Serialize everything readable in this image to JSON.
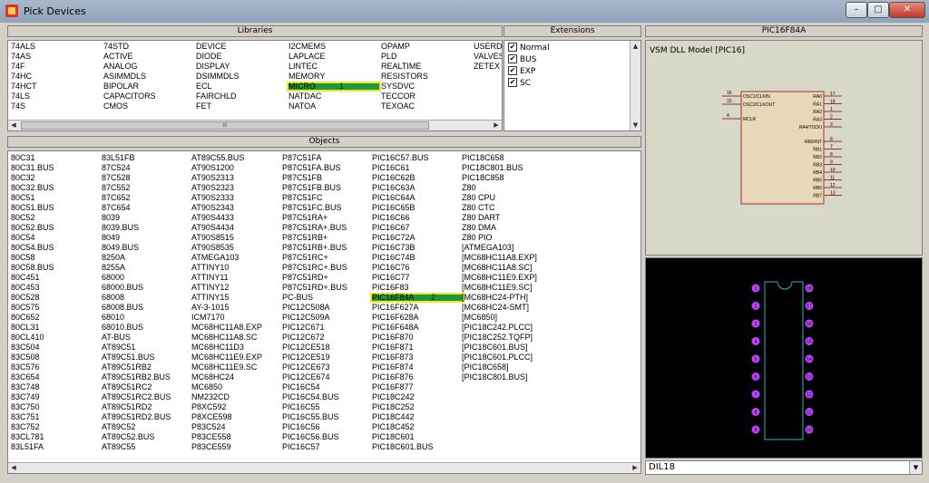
{
  "window": {
    "title": "Pick Devices",
    "min": "–",
    "max": "□",
    "close": "✕"
  },
  "libraries": {
    "header": "Libraries",
    "columns": [
      [
        "74ALS",
        "74AS",
        "74F",
        "74HC",
        "74HCT",
        "74LS",
        "74S"
      ],
      [
        "74STD",
        "ACTIVE",
        "ANALOG",
        "ASIMMDLS",
        "BIPOLAR",
        "CAPACITORS",
        "CMOS"
      ],
      [
        "DEVICE",
        "DIODE",
        "DISPLAY",
        "DSIMMDLS",
        "ECL",
        "FAIRCHLD",
        "FET"
      ],
      [
        "I2CMEMS",
        "LAPLACE",
        "LINTEC",
        "MEMORY",
        "MICRO",
        "NATDAC",
        "NATOA"
      ],
      [
        "OPAMP",
        "PLD",
        "REALTIME",
        "RESISTORS",
        "SYSDVC",
        "TECCOR",
        "TEXOAC"
      ],
      [
        "USERD",
        "VALVES",
        "ZETEX"
      ]
    ],
    "highlight_number": "1",
    "scroll_thumb": "III"
  },
  "extensions": {
    "header": "Extensions",
    "items": [
      {
        "label": "Normal",
        "checked": "✔"
      },
      {
        "label": "BUS",
        "checked": "✔"
      },
      {
        "label": "EXP",
        "checked": "✔"
      },
      {
        "label": "SC",
        "checked": "✔"
      }
    ]
  },
  "objects": {
    "header": "Objects",
    "columns": [
      [
        "80C31",
        "80C31.BUS",
        "80C32",
        "80C32.BUS",
        "80C51",
        "80C51.BUS",
        "80C52",
        "80C52.BUS",
        "80C54",
        "80C54.BUS",
        "80C58",
        "80C58.BUS",
        "80C451",
        "80C453",
        "80C528",
        "80C575",
        "80C652",
        "80CL31",
        "80CL410",
        "83C504",
        "83C508",
        "83C576",
        "83C654",
        "83C748",
        "83C749",
        "83C750",
        "83C751",
        "83C752",
        "83CL781",
        "83L51FA"
      ],
      [
        "83L51FB",
        "87C524",
        "87C528",
        "87C552",
        "87C652",
        "87C654",
        "8039",
        "8039.BUS",
        "8049",
        "8049.BUS",
        "8250A",
        "8255A",
        "68000",
        "68000.BUS",
        "68008",
        "68008.BUS",
        "68010",
        "68010.BUS",
        "AT-BUS",
        "AT89C51",
        "AT89C51.BUS",
        "AT89C51RB2",
        "AT89C51RB2.BUS",
        "AT89C51RC2",
        "AT89C51RC2.BUS",
        "AT89C51RD2",
        "AT89C51RD2.BUS",
        "AT89C52",
        "AT89C52.BUS",
        "AT89C55"
      ],
      [
        "AT89C55.BUS",
        "AT90S1200",
        "AT90S2313",
        "AT90S2323",
        "AT90S2333",
        "AT90S2343",
        "AT90S4433",
        "AT90S4434",
        "AT90S8515",
        "AT90S8535",
        "ATMEGA103",
        "ATTINY10",
        "ATTINY11",
        "ATTINY12",
        "ATTINY15",
        "AY-3-1015",
        "ICM7170",
        "MC68HC11A8.EXP",
        "MC68HC11A8.SC",
        "MC68HC11D3",
        "MC68HC11E9.EXP",
        "MC68HC11E9.SC",
        "MC68HC24",
        "MC6850",
        "NM232CD",
        "P8XC592",
        "P8XCE598",
        "P83C524",
        "P83CE558",
        "P83CE559"
      ],
      [
        "P87C51FA",
        "P87C51FA.BUS",
        "P87C51FB",
        "P87C51FB.BUS",
        "P87C51FC",
        "P87C51FC.BUS",
        "P87C51RA+",
        "P87C51RA+.BUS",
        "P87C51RB+",
        "P87C51RB+.BUS",
        "P87C51RC+",
        "P87C51RC+.BUS",
        "P87C51RD+",
        "P87C51RD+.BUS",
        "PC-BUS",
        "PIC12C508A",
        "PIC12C509A",
        "PIC12C671",
        "PIC12C672",
        "PIC12CE518",
        "PIC12CE519",
        "PIC12CE673",
        "PIC12CE674",
        "PIC16C54",
        "PIC16C54.BUS",
        "PIC16C55",
        "PIC16C55.BUS",
        "PIC16C56",
        "PIC16C56.BUS",
        "PIC16C57"
      ],
      [
        "PIC16C57.BUS",
        "PIC16C61",
        "PIC16C62B",
        "PIC16C63A",
        "PIC16C64A",
        "PIC16C65B",
        "PIC16C66",
        "PIC16C67",
        "PIC16C72A",
        "PIC16C73B",
        "PIC16C74B",
        "PIC16C76",
        "PIC16C77",
        "PIC16F83",
        "PIC16F84A",
        "PIC16F627A",
        "PIC16F628A",
        "PIC16F648A",
        "PIC16F870",
        "PIC16F871",
        "PIC16F873",
        "PIC16F874",
        "PIC16F876",
        "PIC16F877",
        "PIC18C242",
        "PIC18C252",
        "PIC18C442",
        "PIC18C452",
        "PIC18C601",
        "PIC18C601.BUS"
      ],
      [
        "PIC18C658",
        "PIC18C801.BUS",
        "PIC18C858",
        "Z80",
        "Z80 CPU",
        "Z80 CTC",
        "Z80 DART",
        "Z80 DMA",
        "Z80 PIO",
        "[ATMEGA103]",
        "[MC68HC11A8.EXP]",
        "[MC68HC11A8.SC]",
        "[MC68HC11E9.EXP]",
        "[MC68HC11E9.SC]",
        "[MC68HC24-PTH]",
        "[MC68HC24-SMT]",
        "[MC6850]",
        "[PIC18C242.PLCC]",
        "[PIC18C252.TQFP]",
        "[PIC18C601.BUS]",
        "[PIC18C601.PLCC]",
        "[PIC18C658]",
        "[PIC18C801.BUS]"
      ]
    ],
    "highlight_number": "2"
  },
  "preview": {
    "header": "PIC16F84A",
    "model_label": "VSM DLL Model [PIC16]",
    "left_pins": [
      {
        "num": "16",
        "name": "OSC1/CLKIN"
      },
      {
        "num": "15",
        "name": "OSC2/CLKOUT"
      },
      {
        "num": "4",
        "name": "MCLR"
      }
    ],
    "right_pins": [
      {
        "num": "17",
        "name": "RA0"
      },
      {
        "num": "18",
        "name": "RA1"
      },
      {
        "num": "1",
        "name": "RA2"
      },
      {
        "num": "2",
        "name": "RA3"
      },
      {
        "num": "3",
        "name": "RA4/T0CKI"
      },
      {
        "num": "6",
        "name": "RB0/INT"
      },
      {
        "num": "7",
        "name": "RB1"
      },
      {
        "num": "8",
        "name": "RB2"
      },
      {
        "num": "9",
        "name": "RB3"
      },
      {
        "num": "10",
        "name": "RB4"
      },
      {
        "num": "11",
        "name": "RB5"
      },
      {
        "num": "12",
        "name": "RB6"
      },
      {
        "num": "13",
        "name": "RB7"
      }
    ],
    "package": "DIL18",
    "dil_left_numbers": [
      "1",
      "2",
      "3",
      "4",
      "5",
      "6",
      "7",
      "8",
      "9"
    ],
    "dil_right_numbers": [
      "18",
      "17",
      "16",
      "15",
      "14",
      "13",
      "12",
      "11",
      "10"
    ]
  },
  "colors": {
    "highlight_fill": "#1d9b3a",
    "highlight_border": "#f5e62a",
    "pad": "#c040ff",
    "outline": "#2bb3c6",
    "chip_body": "#e8d8b8",
    "chip_border": "#a03030"
  }
}
